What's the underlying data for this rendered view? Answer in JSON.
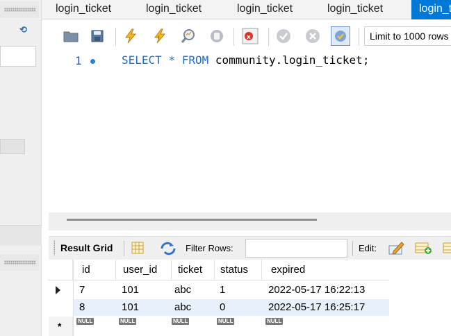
{
  "query_tabs": [
    "login_ticket",
    "login_ticket",
    "login_ticket",
    "login_ticket",
    "login_t"
  ],
  "toolbar": {
    "limit_label": "Limit to 1000 rows",
    "icons": [
      "open-folder-icon",
      "save-icon",
      "execute-icon",
      "execute-current-icon",
      "explain-icon",
      "stop-icon",
      "toggle-error-icon",
      "commit-icon",
      "rollback-icon",
      "autocommit-icon"
    ]
  },
  "editor": {
    "line_number": "1",
    "kw_select": "SELECT",
    "star": "*",
    "kw_from": "FROM",
    "table_ref": "community.login_ticket;"
  },
  "result": {
    "result_grid_label": "Result Grid",
    "filter_rows_label": "Filter Rows:",
    "filter_value": "",
    "edit_label": "Edit:",
    "columns": [
      "id",
      "user_id",
      "ticket",
      "status",
      "expired"
    ],
    "rows": [
      [
        "7",
        "101",
        "abc",
        "1",
        "2022-05-17 16:22:13"
      ],
      [
        "8",
        "101",
        "abc",
        "0",
        "2022-05-17 16:25:17"
      ]
    ],
    "null_label": "NULL",
    "new_row_marker": "*"
  },
  "colors": {
    "accent": "#0078d7",
    "keyword": "#1e6fc9",
    "selected_row": "#e8f0fb"
  }
}
